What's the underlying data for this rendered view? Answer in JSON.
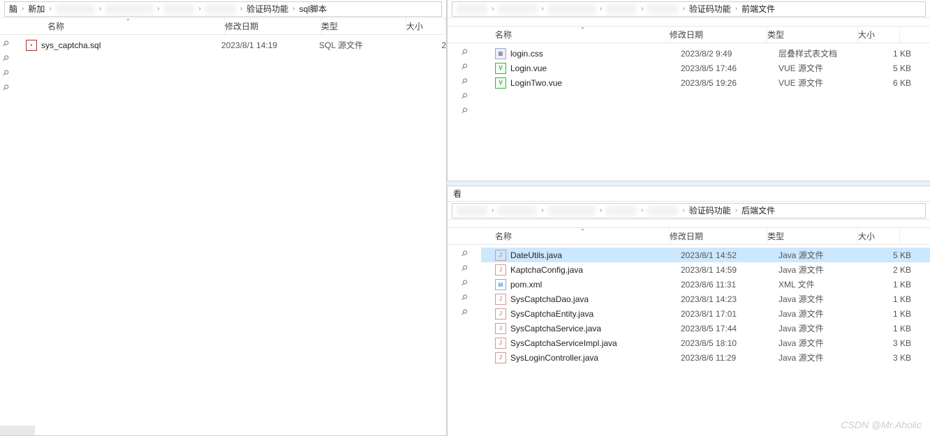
{
  "columns": {
    "name": "名称",
    "date": "修改日期",
    "type": "类型",
    "size": "大小"
  },
  "view_label": "看",
  "left": {
    "crumbs_prefix": [
      "脑",
      "新加",
      "",
      "",
      "",
      ""
    ],
    "crumbs": [
      "验证码功能",
      "sql脚本"
    ],
    "files": [
      {
        "icon": "sql",
        "name": "sys_captcha.sql",
        "date": "2023/8/1 14:19",
        "type": "SQL 源文件",
        "size": "2"
      }
    ]
  },
  "tr": {
    "crumbs_prefix": [
      "",
      "",
      "",
      "",
      ""
    ],
    "crumbs": [
      "验证码功能",
      "前端文件"
    ],
    "files": [
      {
        "icon": "css",
        "name": "login.css",
        "date": "2023/8/2 9:49",
        "type": "层叠样式表文档",
        "size": "1 KB"
      },
      {
        "icon": "vue",
        "name": "Login.vue",
        "date": "2023/8/5 17:46",
        "type": "VUE 源文件",
        "size": "5 KB"
      },
      {
        "icon": "vue",
        "name": "LoginTwo.vue",
        "date": "2023/8/5 19:26",
        "type": "VUE 源文件",
        "size": "6 KB"
      }
    ]
  },
  "br": {
    "crumbs_prefix": [
      "",
      "",
      "",
      "",
      ""
    ],
    "crumbs": [
      "验证码功能",
      "后端文件"
    ],
    "selected": 0,
    "files": [
      {
        "icon": "java",
        "name": "DateUtils.java",
        "date": "2023/8/1 14:52",
        "type": "Java 源文件",
        "size": "5 KB"
      },
      {
        "icon": "java",
        "name": "KaptchaConfig.java",
        "date": "2023/8/1 14:59",
        "type": "Java 源文件",
        "size": "2 KB"
      },
      {
        "icon": "xml",
        "name": "pom.xml",
        "date": "2023/8/6 11:31",
        "type": "XML 文件",
        "size": "1 KB"
      },
      {
        "icon": "java",
        "name": "SysCaptchaDao.java",
        "date": "2023/8/1 14:23",
        "type": "Java 源文件",
        "size": "1 KB"
      },
      {
        "icon": "java",
        "name": "SysCaptchaEntity.java",
        "date": "2023/8/1 17:01",
        "type": "Java 源文件",
        "size": "1 KB"
      },
      {
        "icon": "java",
        "name": "SysCaptchaService.java",
        "date": "2023/8/5 17:44",
        "type": "Java 源文件",
        "size": "1 KB"
      },
      {
        "icon": "java",
        "name": "SysCaptchaServiceImpl.java",
        "date": "2023/8/5 18:10",
        "type": "Java 源文件",
        "size": "3 KB"
      },
      {
        "icon": "java",
        "name": "SysLoginController.java",
        "date": "2023/8/6 11:29",
        "type": "Java 源文件",
        "size": "3 KB"
      }
    ]
  },
  "watermark": "CSDN @Mr.Aholic"
}
